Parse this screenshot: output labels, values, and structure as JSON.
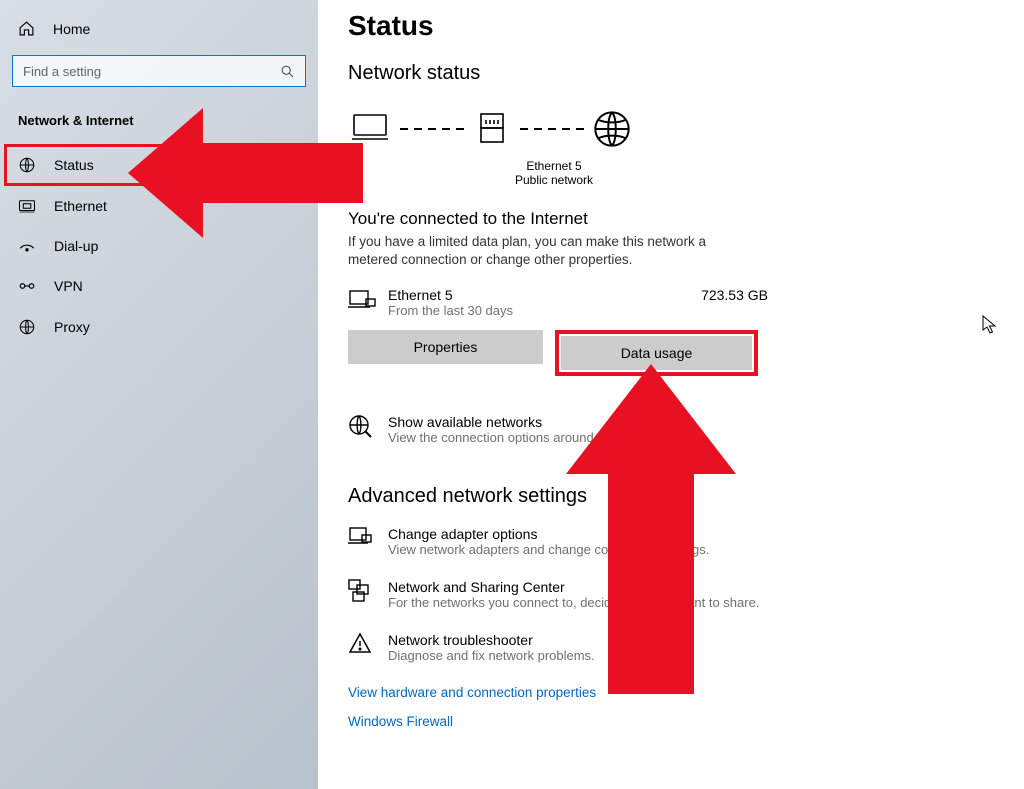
{
  "sidebar": {
    "home_label": "Home",
    "search_placeholder": "Find a setting",
    "category": "Network & Internet",
    "items": [
      {
        "label": "Status",
        "icon": "status-icon",
        "highlighted": true
      },
      {
        "label": "Ethernet",
        "icon": "ethernet-icon"
      },
      {
        "label": "Dial-up",
        "icon": "dialup-icon"
      },
      {
        "label": "VPN",
        "icon": "vpn-icon"
      },
      {
        "label": "Proxy",
        "icon": "globe-icon"
      }
    ]
  },
  "main": {
    "page_title": "Status",
    "section_network_status": "Network status",
    "diagram": {
      "adapter_label": "Ethernet 5",
      "network_type": "Public network"
    },
    "connected": {
      "heading": "You're connected to the Internet",
      "desc": "If you have a limited data plan, you can make this network a metered connection or change other properties.",
      "adapter": "Ethernet 5",
      "period": "From the last 30 days",
      "usage": "723.53 GB"
    },
    "buttons": {
      "properties": "Properties",
      "data_usage": "Data usage"
    },
    "show_networks": {
      "title": "Show available networks",
      "desc": "View the connection options around you."
    },
    "section_advanced": "Advanced network settings",
    "adapter_opts": {
      "title": "Change adapter options",
      "desc": "View network adapters and change connection settings."
    },
    "sharing_center": {
      "title": "Network and Sharing Center",
      "desc": "For the networks you connect to, decide what you want to share."
    },
    "troubleshooter": {
      "title": "Network troubleshooter",
      "desc": "Diagnose and fix network problems."
    },
    "link_hw": "View hardware and connection properties",
    "link_fw": "Windows Firewall"
  },
  "annotations": {
    "highlight_color": "#e81123"
  }
}
